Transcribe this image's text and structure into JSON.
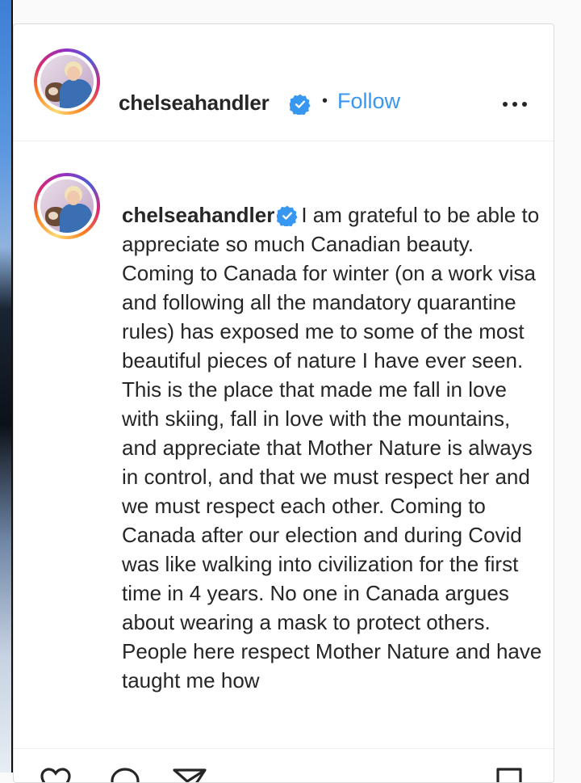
{
  "post": {
    "username": "chelseahandler",
    "separator": "•",
    "follow_label": "Follow",
    "more_icon": "more-options-icon",
    "verified_icon": "verified-badge-icon",
    "caption_username": "chelseahandler",
    "caption_text": "I am grateful to be able to appreciate so much Canadian beauty. Coming to Canada for winter (on a work visa and following all the mandatory quarantine rules) has exposed me to some of the most beautiful pieces of nature I have ever seen. This is the place that made me fall in love with skiing, fall in love with the mountains, and appreciate that Mother Nature is always in control, and that we must respect her and we must respect each other. Coming to Canada after our election and during Covid was like walking into civilization for the first time in 4 years. No one in Canada argues about wearing a mask to protect others. People here respect Mother Nature and have taught me how"
  },
  "actions": {
    "like_icon": "heart-icon",
    "comment_icon": "comment-icon",
    "share_icon": "share-icon",
    "save_icon": "bookmark-icon"
  },
  "colors": {
    "link_blue": "#3897f0",
    "verified_blue": "#3897f0",
    "text": "#262626",
    "border": "#dbdbdb"
  }
}
